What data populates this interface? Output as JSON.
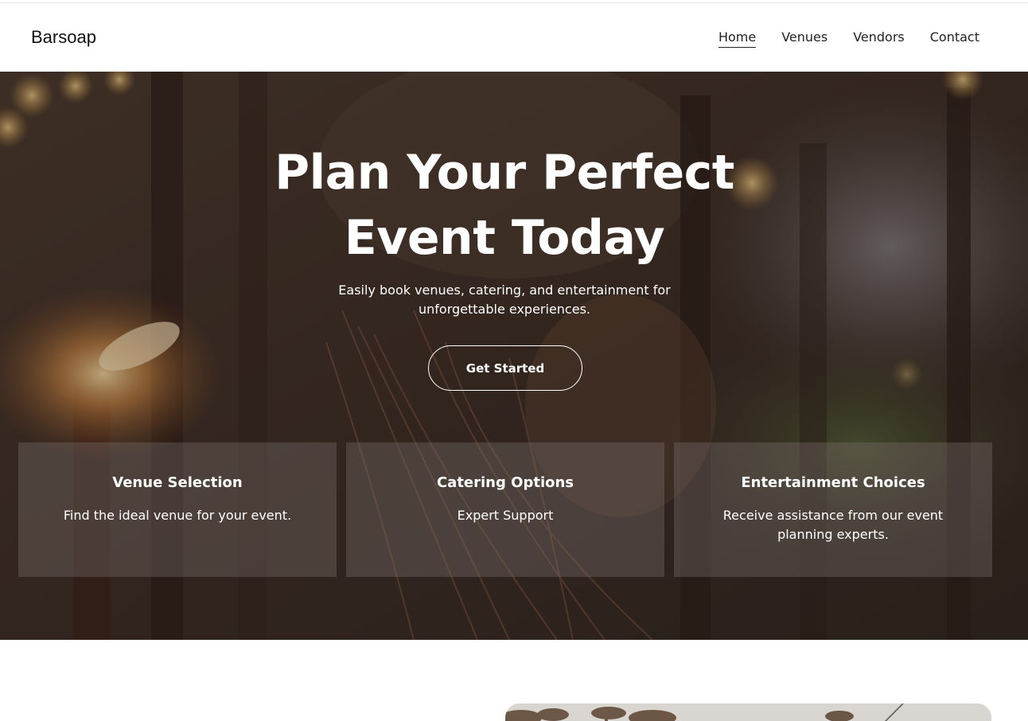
{
  "header": {
    "brand": "Barsoap",
    "nav": [
      {
        "label": "Home",
        "active": true
      },
      {
        "label": "Venues",
        "active": false
      },
      {
        "label": "Vendors",
        "active": false
      },
      {
        "label": "Contact",
        "active": false
      }
    ]
  },
  "hero": {
    "title_line1": "Plan Your Perfect",
    "title_line2": "Event Today",
    "subtitle": "Easily book venues, catering, and entertainment for unforgettable experiences.",
    "cta_label": "Get Started",
    "cards": [
      {
        "title": "Venue Selection",
        "text": "Find the ideal venue for your event."
      },
      {
        "title": "Catering Options",
        "text": "Expert Support"
      },
      {
        "title": "Entertainment Choices",
        "text": "Receive assistance from our event planning experts."
      }
    ]
  },
  "colors": {
    "overlay": "#3a2a22",
    "text_light": "#ffffff",
    "nav_text": "#222222"
  }
}
